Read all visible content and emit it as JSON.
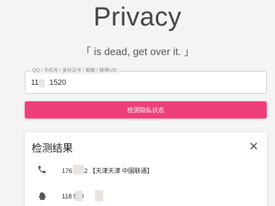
{
  "header": {
    "title": "Privacy",
    "subtitle": "「 is dead, get over it. 」"
  },
  "search": {
    "label": "QQ / 手机号 / 身份证号 / 邮箱 / 微博UID",
    "value": "11     1520"
  },
  "detect_button": {
    "label": "检测隐私状态"
  },
  "results": {
    "title": "检测结果",
    "rows": [
      {
        "icon": "phone-icon",
        "text": "176      3052 【天津天津 中国联通】"
      },
      {
        "icon": "qq-icon",
        "text": "118          520"
      }
    ]
  },
  "colors": {
    "accent": "#ee3f78",
    "background": "#f4f4f4"
  }
}
